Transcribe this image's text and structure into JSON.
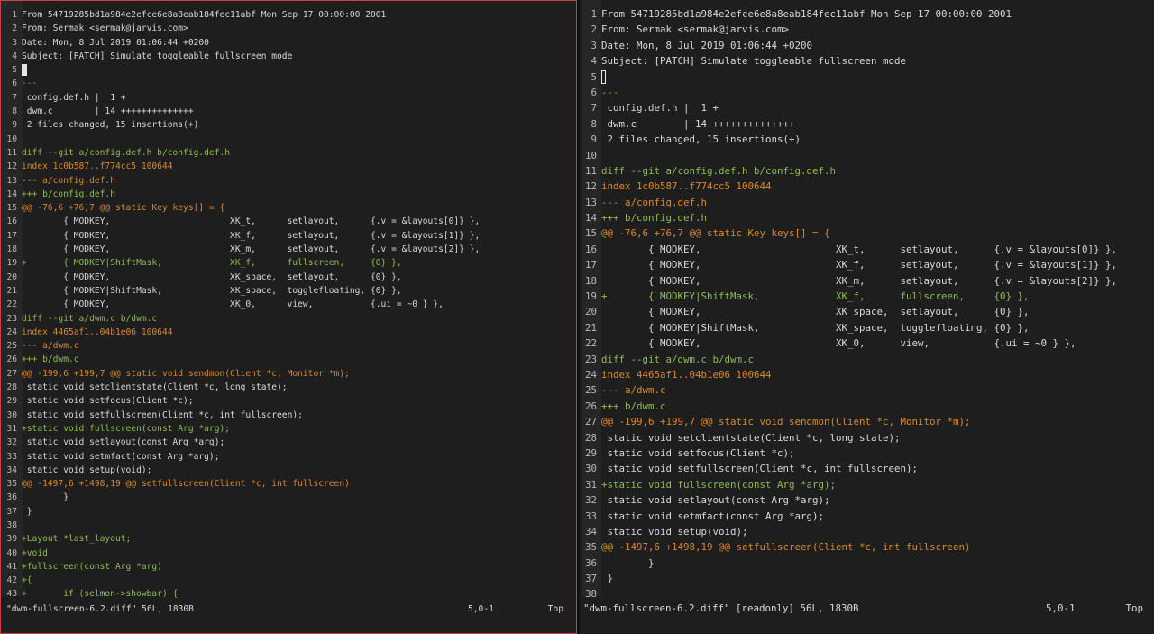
{
  "buffer": {
    "lines": [
      {
        "n": "1",
        "text": "From 54719285bd1a984e2efce6e8a8eab184fec11abf Mon Sep 17 00:00:00 2001",
        "color": "plain"
      },
      {
        "n": "2",
        "text": "From: Sermak <sermak@jarvis.com>",
        "color": "plain"
      },
      {
        "n": "3",
        "text": "Date: Mon, 8 Jul 2019 01:06:44 +0200",
        "color": "plain"
      },
      {
        "n": "4",
        "text": "Subject: [PATCH] Simulate toggleable fullscreen mode",
        "color": "plain"
      },
      {
        "n": "5",
        "text": "",
        "color": "plain",
        "cursor": true
      },
      {
        "n": "6",
        "text": "---",
        "color": "orange"
      },
      {
        "n": "7",
        "text": " config.def.h |  1 +",
        "color": "plain"
      },
      {
        "n": "8",
        "text": " dwm.c        | 14 ++++++++++++++",
        "color": "plain"
      },
      {
        "n": "9",
        "text": " 2 files changed, 15 insertions(+)",
        "color": "plain"
      },
      {
        "n": "10",
        "text": "",
        "color": "plain"
      },
      {
        "n": "11",
        "text": "diff --git a/config.def.h b/config.def.h",
        "color": "green"
      },
      {
        "n": "12",
        "text": "index 1c0b587..f774cc5 100644",
        "color": "orange"
      },
      {
        "n": "13",
        "text": "--- a/config.def.h",
        "color": "orange"
      },
      {
        "n": "14",
        "text": "+++ b/config.def.h",
        "color": "green"
      },
      {
        "n": "15",
        "text": "@@ -76,6 +76,7 @@ static Key keys[] = {",
        "color": "orange"
      },
      {
        "n": "16",
        "text": "        { MODKEY,                       XK_t,      setlayout,      {.v = &layouts[0]} },",
        "color": "plain"
      },
      {
        "n": "17",
        "text": "        { MODKEY,                       XK_f,      setlayout,      {.v = &layouts[1]} },",
        "color": "plain"
      },
      {
        "n": "18",
        "text": "        { MODKEY,                       XK_m,      setlayout,      {.v = &layouts[2]} },",
        "color": "plain"
      },
      {
        "n": "19",
        "text": "+       { MODKEY|ShiftMask,             XK_f,      fullscreen,     {0} },",
        "color": "green"
      },
      {
        "n": "20",
        "text": "        { MODKEY,                       XK_space,  setlayout,      {0} },",
        "color": "plain"
      },
      {
        "n": "21",
        "text": "        { MODKEY|ShiftMask,             XK_space,  togglefloating, {0} },",
        "color": "plain"
      },
      {
        "n": "22",
        "text": "        { MODKEY,                       XK_0,      view,           {.ui = ~0 } },",
        "color": "plain"
      },
      {
        "n": "23",
        "text": "diff --git a/dwm.c b/dwm.c",
        "color": "green"
      },
      {
        "n": "24",
        "text": "index 4465af1..04b1e06 100644",
        "color": "orange"
      },
      {
        "n": "25",
        "text": "--- a/dwm.c",
        "color": "orange"
      },
      {
        "n": "26",
        "text": "+++ b/dwm.c",
        "color": "green"
      },
      {
        "n": "27",
        "text": "@@ -199,6 +199,7 @@ static void sendmon(Client *c, Monitor *m);",
        "color": "orange"
      },
      {
        "n": "28",
        "text": " static void setclientstate(Client *c, long state);",
        "color": "plain"
      },
      {
        "n": "29",
        "text": " static void setfocus(Client *c);",
        "color": "plain"
      },
      {
        "n": "30",
        "text": " static void setfullscreen(Client *c, int fullscreen);",
        "color": "plain"
      },
      {
        "n": "31",
        "text": "+static void fullscreen(const Arg *arg);",
        "color": "green"
      },
      {
        "n": "32",
        "text": " static void setlayout(const Arg *arg);",
        "color": "plain"
      },
      {
        "n": "33",
        "text": " static void setmfact(const Arg *arg);",
        "color": "plain"
      },
      {
        "n": "34",
        "text": " static void setup(void);",
        "color": "plain"
      },
      {
        "n": "35",
        "text": "@@ -1497,6 +1498,19 @@ setfullscreen(Client *c, int fullscreen)",
        "color": "orange"
      },
      {
        "n": "36",
        "text": "        }",
        "color": "plain"
      },
      {
        "n": "37",
        "text": " }",
        "color": "plain"
      },
      {
        "n": "38",
        "text": "",
        "color": "plain"
      },
      {
        "n": "39",
        "text": "+Layout *last_layout;",
        "color": "green"
      },
      {
        "n": "40",
        "text": "+void",
        "color": "green"
      },
      {
        "n": "41",
        "text": "+fullscreen(const Arg *arg)",
        "color": "green"
      },
      {
        "n": "42",
        "text": "+{",
        "color": "green"
      },
      {
        "n": "43",
        "text": "+       if (selmon->showbar) {",
        "color": "green"
      }
    ]
  },
  "left_status": {
    "filename": "\"dwm-fullscreen-6.2.diff\" 56L, 1830B",
    "position": "5,0-1",
    "scroll": "Top"
  },
  "right_status": {
    "filename": "\"dwm-fullscreen-6.2.diff\" [readonly] 56L, 1830B",
    "position": "5,0-1",
    "scroll": "Top"
  },
  "left_visible_lines": 43,
  "right_visible_lines": 38,
  "colors": {
    "green": "#8fbc4f",
    "orange": "#d9892e",
    "text": "#d8d8d8",
    "background": "#1e1e1e",
    "active_border": "#d04040"
  }
}
